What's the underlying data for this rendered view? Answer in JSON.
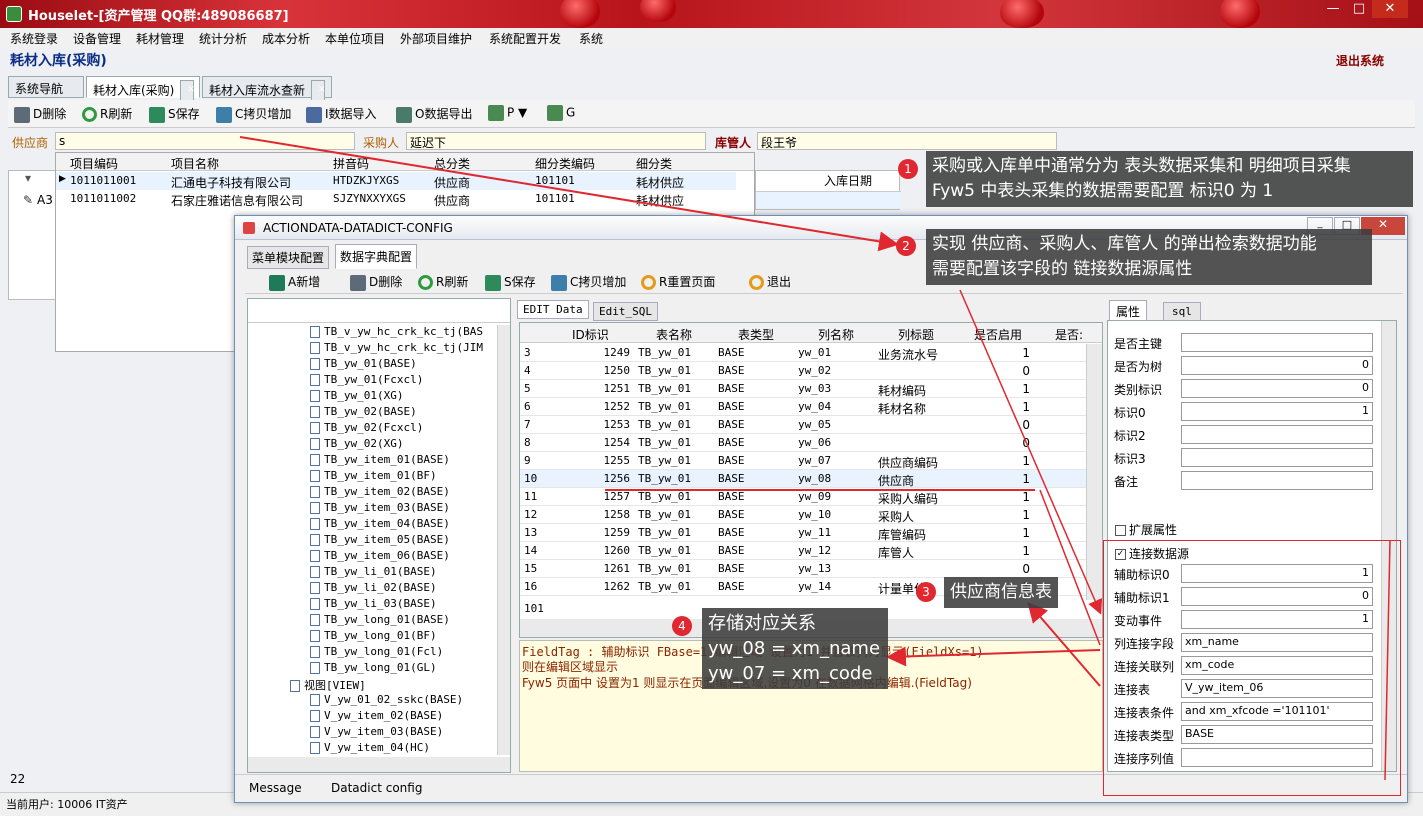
{
  "window": {
    "title": "Houselet-[资产管理 QQ群:489086687]",
    "min_icon": "minimize-icon",
    "max_icon": "maximize-icon",
    "close_icon": "close-icon"
  },
  "menu": [
    "系统登录",
    "设备管理",
    "耗材管理",
    "统计分析",
    "成本分析",
    "本单位项目",
    "外部项目维护",
    "系统配置开发",
    "系统"
  ],
  "page": {
    "title": "耗材入库(采购)",
    "exit": "退出系统"
  },
  "tabs": [
    "系统导航",
    "耗材入库(采购)",
    "耗材入库流水查新"
  ],
  "toolbar": [
    "D删除",
    "R刷新",
    "S保存",
    "C拷贝增加",
    "I数据导入",
    "O数据导出",
    "P ▼",
    "G"
  ],
  "header_fields": {
    "supplier_label": "供应商",
    "supplier_value": "s",
    "buyer_label": "采购人",
    "buyer_value": "延迟下",
    "keeper_label": "库管人",
    "keeper_value": "段王爷"
  },
  "popup_grid": {
    "columns": [
      "项目编码",
      "项目名称",
      "拼音码",
      "总分类",
      "细分类编码",
      "细分类"
    ],
    "rows": [
      [
        "1011011001",
        "汇通电子科技有限公司",
        "HTDZKJYXGS",
        "供应商",
        "101101",
        "耗材供应"
      ],
      [
        "1011011002",
        "石家庄雅诺信息有限公司",
        "SJZYNXXYXGS",
        "供应商",
        "101101",
        "耗材供应"
      ]
    ]
  },
  "main_grid": {
    "column": "入库日期",
    "row_prefix": "A3"
  },
  "dialog": {
    "title": "ACTIONDATA-DATADICT-CONFIG",
    "tabs": [
      "菜单模块配置",
      "数据字典配置"
    ],
    "toolbar": [
      "A新增",
      "D删除",
      "R刷新",
      "S保存",
      "C拷贝增加",
      "R重置页面",
      "退出"
    ],
    "tree": [
      "TB_v_yw_hc_crk_kc_tj(BAS",
      "TB_v_yw_hc_crk_kc_tj(JIM",
      "TB_yw_01(BASE)",
      "TB_yw_01(Fcxcl)",
      "TB_yw_01(XG)",
      "TB_yw_02(BASE)",
      "TB_yw_02(Fcxcl)",
      "TB_yw_02(XG)",
      "TB_yw_item_01(BASE)",
      "TB_yw_item_01(BF)",
      "TB_yw_item_02(BASE)",
      "TB_yw_item_03(BASE)",
      "TB_yw_item_04(BASE)",
      "TB_yw_item_05(BASE)",
      "TB_yw_item_06(BASE)",
      "TB_yw_li_01(BASE)",
      "TB_yw_li_02(BASE)",
      "TB_yw_li_03(BASE)",
      "TB_yw_long_01(BASE)",
      "TB_yw_long_01(BF)",
      "TB_yw_long_01(Fcl)",
      "TB_yw_long_01(GL)",
      "视图[VIEW]",
      "V_yw_01_02_sskc(BASE)",
      "V_yw_item_02(BASE)",
      "V_yw_item_03(BASE)",
      "V_yw_item_04(HC)"
    ],
    "edit_tabs": [
      "EDIT Data",
      "Edit_SQL"
    ],
    "grid_columns": [
      "ID标识",
      "表名称",
      "表类型",
      "列名称",
      "列标题",
      "是否启用",
      "是否:"
    ],
    "grid_rows": [
      [
        "3",
        "1249",
        "TB_yw_01",
        "BASE",
        "yw_01",
        "业务流水号",
        "1"
      ],
      [
        "4",
        "1250",
        "TB_yw_01",
        "BASE",
        "yw_02",
        "",
        "0"
      ],
      [
        "5",
        "1251",
        "TB_yw_01",
        "BASE",
        "yw_03",
        "耗材编码",
        "1"
      ],
      [
        "6",
        "1252",
        "TB_yw_01",
        "BASE",
        "yw_04",
        "耗材名称",
        "1"
      ],
      [
        "7",
        "1253",
        "TB_yw_01",
        "BASE",
        "yw_05",
        "",
        "0"
      ],
      [
        "8",
        "1254",
        "TB_yw_01",
        "BASE",
        "yw_06",
        "",
        "0"
      ],
      [
        "9",
        "1255",
        "TB_yw_01",
        "BASE",
        "yw_07",
        "供应商编码",
        "1"
      ],
      [
        "10",
        "1256",
        "TB_yw_01",
        "BASE",
        "yw_08",
        "供应商",
        "1"
      ],
      [
        "11",
        "1257",
        "TB_yw_01",
        "BASE",
        "yw_09",
        "采购人编码",
        "1"
      ],
      [
        "12",
        "1258",
        "TB_yw_01",
        "BASE",
        "yw_10",
        "采购人",
        "1"
      ],
      [
        "13",
        "1259",
        "TB_yw_01",
        "BASE",
        "yw_11",
        "库管编码",
        "1"
      ],
      [
        "14",
        "1260",
        "TB_yw_01",
        "BASE",
        "yw_12",
        "库管人",
        "1"
      ],
      [
        "15",
        "1261",
        "TB_yw_01",
        "BASE",
        "yw_13",
        "",
        "0"
      ],
      [
        "16",
        "1262",
        "TB_yw_01",
        "BASE",
        "yw_14",
        "计量单位",
        "1"
      ]
    ],
    "grid_footer": "101",
    "message_lines": [
      "FieldTag : 辅助标识 FBase=1 编辑区域 设置为1 并且该列为显示(FieldXs=1)",
      "则在编辑区域显示",
      "Fyw5 页面中 设置为1 则显示在页面编辑区域,设置为0 在数据网格内编辑.(FieldTag)"
    ],
    "prop_tabs": [
      "属性",
      "sql"
    ],
    "props": [
      [
        "是否主键",
        ""
      ],
      [
        "是否为树",
        "0"
      ],
      [
        "类别标识",
        "0"
      ],
      [
        "标识0",
        "1"
      ],
      [
        "标识2",
        ""
      ],
      [
        "标识3",
        ""
      ],
      [
        "备注",
        ""
      ]
    ],
    "ext_label": "扩展属性",
    "link_label": "连接数据源",
    "link_props": [
      [
        "辅助标识0",
        "1"
      ],
      [
        "辅助标识1",
        "0"
      ],
      [
        "变动事件",
        "1"
      ],
      [
        "列连接字段",
        "xm_name"
      ],
      [
        "连接关联列",
        "xm_code"
      ],
      [
        "连接表",
        "V_yw_item_06"
      ],
      [
        "连接表条件",
        "and xm_xfcode ='101101'"
      ],
      [
        "连接表类型",
        "BASE"
      ],
      [
        "连接序列值",
        ""
      ]
    ],
    "status_tabs": [
      "Message",
      "Datadict config"
    ]
  },
  "callouts": {
    "c1": {
      "n": "1",
      "l1": "采购或入库单中通常分为 表头数据采集和 明细项目采集",
      "l2": "Fyw5 中表头采集的数据需要配置 标识0 为 1"
    },
    "c2": {
      "n": "2",
      "l1": "实现 供应商、采购人、库管人 的弹出检索数据功能",
      "l2": "需要配置该字段的 链接数据源属性"
    },
    "c3": {
      "n": "3",
      "l1": "供应商信息表"
    },
    "c4": {
      "n": "4",
      "l1": "存储对应关系",
      "l2": "yw_08 = xm_name",
      "l3": "yw_07 = xm_code"
    }
  },
  "statusbar": {
    "count": "22",
    "user": "当前用户: 10006 IT资产"
  },
  "colors": {
    "accent_red": "#e02830",
    "title_blue": "#0b2f86",
    "label_orange": "#b06000"
  }
}
